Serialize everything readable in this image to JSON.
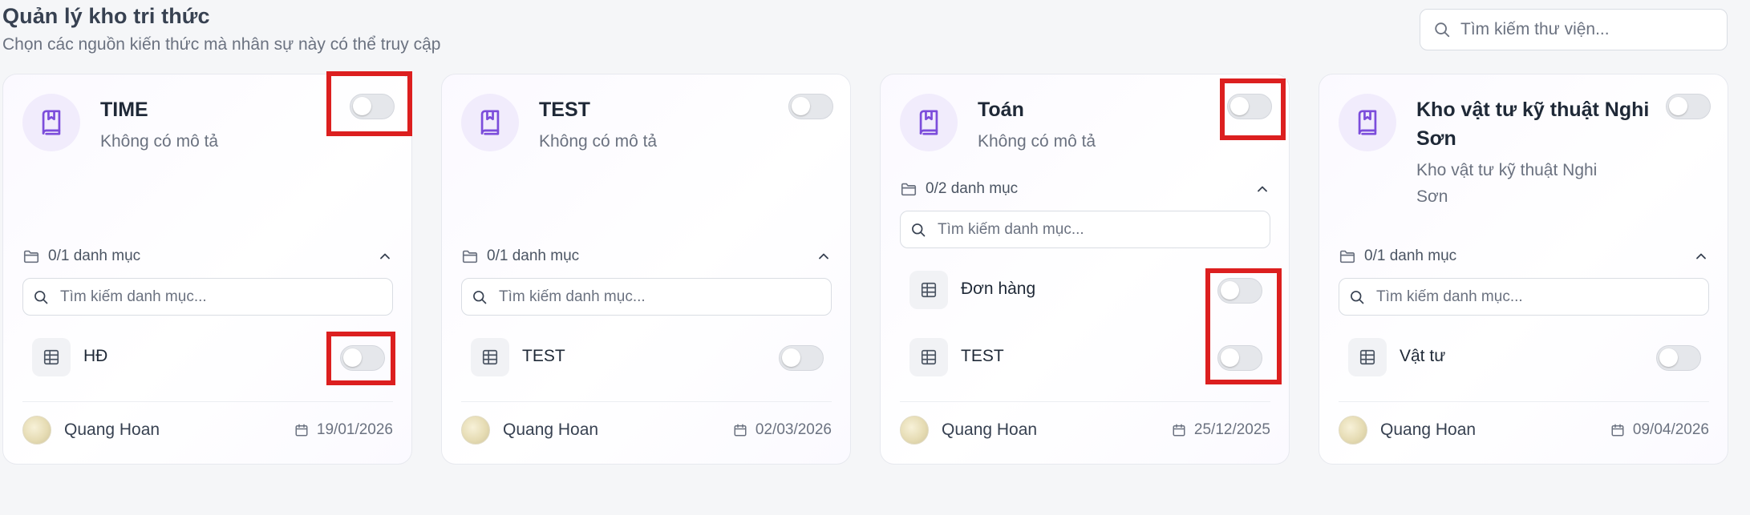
{
  "header": {
    "title": "Quản lý kho tri thức",
    "subtitle": "Chọn các nguồn kiến thức mà nhân sự này có thể truy cập"
  },
  "library_search": {
    "placeholder": "Tìm kiếm thư viện..."
  },
  "colors": {
    "accent_purple": "#7c4ddb",
    "highlight_red": "#dc1f1f",
    "toggle_off": "#e5e7eb"
  },
  "cards": [
    {
      "title": "TIME",
      "description": "Không có mô tả",
      "enabled": false,
      "category_count": "0/1 danh mục",
      "category_search_placeholder": "Tìm kiếm danh mục...",
      "categories": [
        {
          "label": "HĐ",
          "enabled": false
        }
      ],
      "author": "Quang Hoan",
      "date": "19/01/2026"
    },
    {
      "title": "TEST",
      "description": "Không có mô tả",
      "enabled": false,
      "category_count": "0/1 danh mục",
      "category_search_placeholder": "Tìm kiếm danh mục...",
      "categories": [
        {
          "label": "TEST",
          "enabled": false
        }
      ],
      "author": "Quang Hoan",
      "date": "02/03/2026"
    },
    {
      "title": "Toán",
      "description": "Không có mô tả",
      "enabled": false,
      "category_count": "0/2 danh mục",
      "category_search_placeholder": "Tìm kiếm danh mục...",
      "categories": [
        {
          "label": "Đơn hàng",
          "enabled": false
        },
        {
          "label": "TEST",
          "enabled": false
        }
      ],
      "author": "Quang Hoan",
      "date": "25/12/2025"
    },
    {
      "title": "Kho vật tư kỹ thuật Nghi Sơn",
      "description": "Kho vật tư kỹ thuật Nghi Sơn",
      "enabled": false,
      "category_count": "0/1 danh mục",
      "category_search_placeholder": "Tìm kiếm danh mục...",
      "categories": [
        {
          "label": "Vật tư",
          "enabled": false
        }
      ],
      "author": "Quang Hoan",
      "date": "09/04/2026"
    }
  ]
}
